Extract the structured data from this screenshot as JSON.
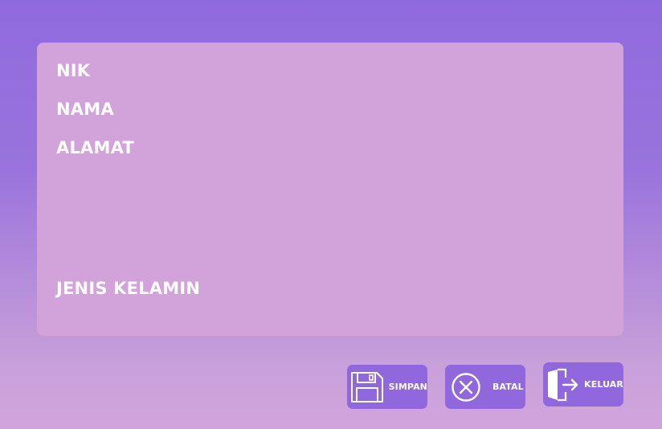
{
  "form": {
    "fields": {
      "nik": "NIK",
      "nama": "NAMA",
      "alamat": "ALAMAT",
      "jenis_kelamin": "JENIS KELAMIN"
    }
  },
  "actions": {
    "simpan": {
      "label": "SIMPAN",
      "icon": "floppy-disk-icon"
    },
    "batal": {
      "label": "BATAL",
      "icon": "cancel-circle-icon"
    },
    "keluar": {
      "label": "KELUAR",
      "icon": "exit-door-icon"
    }
  },
  "colors": {
    "background_top": "#8f6ade",
    "background_bottom": "#d2a4dc",
    "panel": "#d2a2da",
    "button": "#9167de",
    "text": "#ffffff"
  }
}
